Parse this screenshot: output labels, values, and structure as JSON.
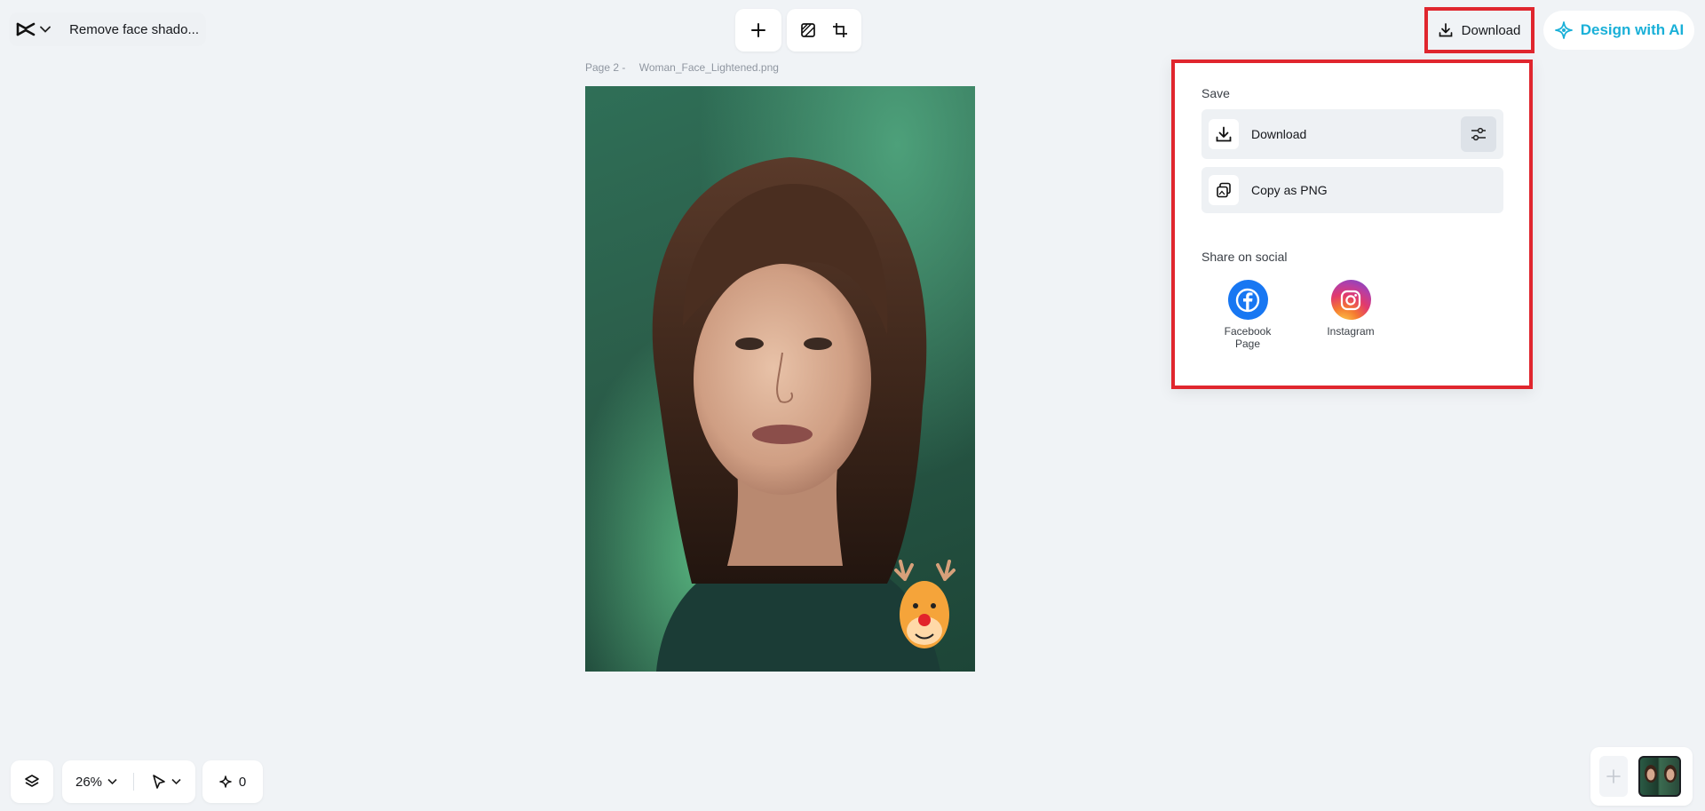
{
  "header": {
    "project_title": "Remove face shado...",
    "download_label": "Download",
    "design_ai_label": "Design with AI"
  },
  "canvas": {
    "page_label": "Page 2 -",
    "file_name": "Woman_Face_Lightened.png"
  },
  "download_panel": {
    "save_title": "Save",
    "download_label": "Download",
    "copy_label": "Copy as PNG",
    "share_title": "Share on social",
    "social": [
      {
        "line1": "Facebook",
        "line2": "Page"
      },
      {
        "line1": "Instagram",
        "line2": ""
      }
    ]
  },
  "bottom_bar": {
    "zoom": "26%",
    "ai_count": "0"
  },
  "colors": {
    "highlight": "#e0262e",
    "ai_accent": "#1ab0d8",
    "facebook": "#1877f2"
  }
}
